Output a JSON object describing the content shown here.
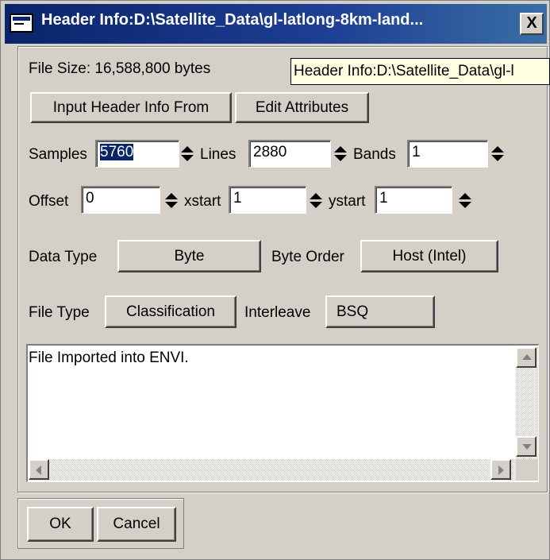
{
  "window": {
    "title": "Header Info:D:\\Satellite_Data\\gl-latlong-8km-land...",
    "close_label": "X"
  },
  "tooltip": {
    "text": "Header Info:D:\\Satellite_Data\\gl-l"
  },
  "file_size": {
    "text": "File Size: 16,588,800 bytes"
  },
  "toolbar": {
    "input_header_label": "Input Header Info From",
    "edit_attributes_label": "Edit Attributes"
  },
  "dims": {
    "samples_label": "Samples",
    "samples_value": "5760",
    "lines_label": "Lines",
    "lines_value": "2880",
    "bands_label": "Bands",
    "bands_value": "1"
  },
  "offsets": {
    "offset_label": "Offset",
    "offset_value": "0",
    "xstart_label": "xstart",
    "xstart_value": "1",
    "ystart_label": "ystart",
    "ystart_value": "1"
  },
  "types": {
    "data_type_label": "Data Type",
    "data_type_value": "Byte",
    "byte_order_label": "Byte Order",
    "byte_order_value": "Host (Intel)",
    "file_type_label": "File Type",
    "file_type_value": "Classification",
    "interleave_label": "Interleave",
    "interleave_value": "BSQ"
  },
  "description": {
    "text": "File Imported into ENVI."
  },
  "footer": {
    "ok_label": "OK",
    "cancel_label": "Cancel"
  },
  "colors": {
    "titlebar": "#0a246a",
    "face": "#d4d0c8",
    "tooltip": "#ffffe1",
    "selection": "#0a246a"
  }
}
